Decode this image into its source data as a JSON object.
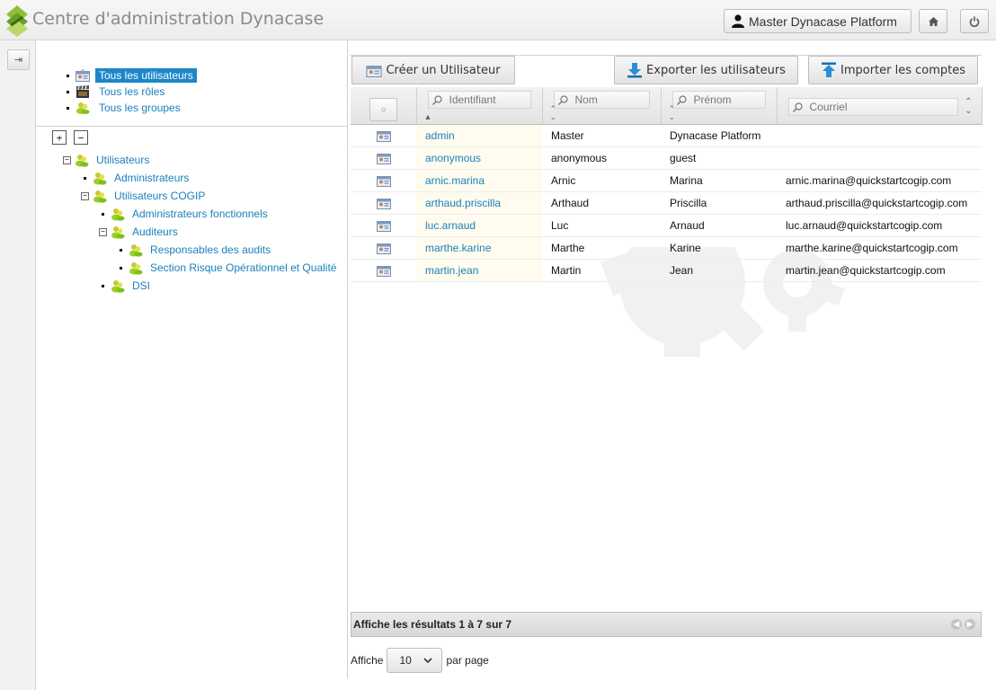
{
  "header": {
    "title": "Centre d'administration Dynacase",
    "user_label": "Master Dynacase Platform",
    "home_icon": "home-icon",
    "power_icon": "power-icon"
  },
  "rail": {
    "toggle_icon": "expand-panel-icon",
    "toggle_glyph": "⇥"
  },
  "quick_links": [
    {
      "label": "Tous les utilisateurs",
      "icon": "user-card-icon",
      "selected": true
    },
    {
      "label": "Tous les rôles",
      "icon": "clapperboard-icon",
      "selected": false
    },
    {
      "label": "Tous les groupes",
      "icon": "group-icon",
      "selected": false
    }
  ],
  "tree_tools": {
    "expand_all": "+",
    "collapse_all": "−"
  },
  "tree": [
    {
      "label": "Utilisateurs",
      "toggle": "−"
    },
    {
      "label": "Administrateurs"
    },
    {
      "label": "Utilisateurs COGIP",
      "toggle": "−"
    },
    {
      "label": "Administrateurs fonctionnels"
    },
    {
      "label": "Auditeurs",
      "toggle": "−"
    },
    {
      "label": "Responsables des audits"
    },
    {
      "label": "Section Risque Opérationnel et Qualité"
    },
    {
      "label": "DSI"
    }
  ],
  "actions": {
    "create": "Créer un Utilisateur",
    "export": "Exporter les utilisateurs",
    "import": "Importer les comptes"
  },
  "columns": {
    "select_all": "○",
    "login": "Identifiant",
    "lastname": "Nom",
    "firstname": "Prénom",
    "email": "Courriel"
  },
  "rows": [
    {
      "login": "admin",
      "lastname": "Master",
      "firstname": "Dynacase Platform",
      "email": ""
    },
    {
      "login": "anonymous",
      "lastname": "anonymous",
      "firstname": "guest",
      "email": ""
    },
    {
      "login": "arnic.marina",
      "lastname": "Arnic",
      "firstname": "Marina",
      "email": "arnic.marina@quickstartcogip.com"
    },
    {
      "login": "arthaud.priscilla",
      "lastname": "Arthaud",
      "firstname": "Priscilla",
      "email": "arthaud.priscilla@quickstartcogip.com"
    },
    {
      "login": "luc.arnaud",
      "lastname": "Luc",
      "firstname": "Arnaud",
      "email": "luc.arnaud@quickstartcogip.com"
    },
    {
      "login": "marthe.karine",
      "lastname": "Marthe",
      "firstname": "Karine",
      "email": "marthe.karine@quickstartcogip.com"
    },
    {
      "login": "martin.jean",
      "lastname": "Martin",
      "firstname": "Jean",
      "email": "martin.jean@quickstartcogip.com"
    }
  ],
  "footer": {
    "results": "Affiche les résultats 1 à 7 sur 7",
    "show_label": "Affiche",
    "page_size": "10",
    "per_page_label": "par page"
  },
  "colors": {
    "link": "#1a7fbb",
    "selected_bg": "#1c86c9",
    "login_cell_bg": "#fffcef"
  }
}
